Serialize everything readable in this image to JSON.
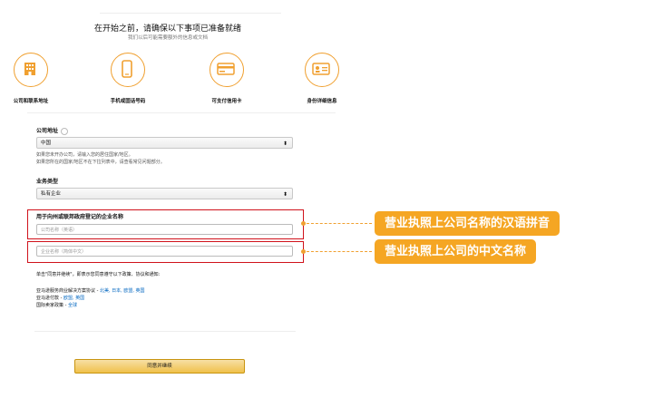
{
  "header": {
    "title": "在开始之前，请确保以下事项已准备就绪",
    "subtitle": "我们以后可能需要额外的信息或文档"
  },
  "steps": [
    {
      "label": "公司和联系地址",
      "icon": "building-icon"
    },
    {
      "label": "手机或固话号码",
      "icon": "phone-icon"
    },
    {
      "label": "可支付信用卡",
      "icon": "credit-card-icon"
    },
    {
      "label": "身份详细信息",
      "icon": "id-card-icon"
    }
  ],
  "form": {
    "address_label": "公司地址",
    "country_value": "中国",
    "country_note_1": "如果您未开办公司，请输入您的居住国家/地区。",
    "country_note_2": "如果您所在的国家/地区不在下拉列表中，请查看常见问题部分。",
    "business_type_label": "业务类型",
    "business_type_value": "私有企业",
    "legal_name_label": "用于向州或联邦政府登记的企业名称",
    "pinyin_placeholder": "公司名称（英语）",
    "chinese_placeholder": "企业名称（简体中文）",
    "agree_text": "单击\"同意并继续\"，即表示您同意遵守以下政策、协议和通知:",
    "policies": [
      {
        "text": "亚马逊服务商业解决方案协议 - ",
        "links": "北美, 日本, 欧盟, 英国"
      },
      {
        "text": "亚马逊付款 - ",
        "links": "欧盟, 英国"
      },
      {
        "text": "国际卖家政策 - ",
        "links": "全球"
      }
    ],
    "submit_label": "同意并继续"
  },
  "callouts": {
    "pinyin": "营业执照上公司名称的汉语拼音",
    "chinese": "营业执照上公司的中文名称"
  },
  "colors": {
    "accent": "#f0a030",
    "callout_bg": "#f5a623",
    "highlight_red": "#d0121b",
    "link": "#0066c0",
    "button": "#f0c14b"
  }
}
